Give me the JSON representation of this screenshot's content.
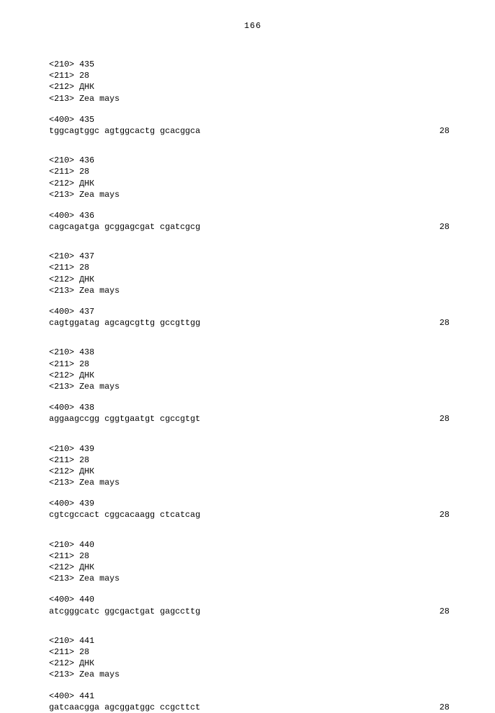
{
  "page_number": "166",
  "entries": [
    {
      "tag210": "<210> 435",
      "tag211": "<211> 28",
      "tag212": "<212> ДНК",
      "tag213": "<213> Zea mays",
      "tag400": "<400> 435",
      "sequence": "tggcagtggc agtggcactg gcacggca",
      "length": "28"
    },
    {
      "tag210": "<210> 436",
      "tag211": "<211> 28",
      "tag212": "<212> ДНК",
      "tag213": "<213> Zea mays",
      "tag400": "<400> 436",
      "sequence": "cagcagatga gcggagcgat cgatcgcg",
      "length": "28"
    },
    {
      "tag210": "<210> 437",
      "tag211": "<211> 28",
      "tag212": "<212> ДНК",
      "tag213": "<213> Zea mays",
      "tag400": "<400> 437",
      "sequence": "cagtggatag agcagcgttg gccgttgg",
      "length": "28"
    },
    {
      "tag210": "<210> 438",
      "tag211": "<211> 28",
      "tag212": "<212> ДНК",
      "tag213": "<213> Zea mays",
      "tag400": "<400> 438",
      "sequence": "aggaagccgg cggtgaatgt cgccgtgt",
      "length": "28"
    },
    {
      "tag210": "<210> 439",
      "tag211": "<211> 28",
      "tag212": "<212> ДНК",
      "tag213": "<213> Zea mays",
      "tag400": "<400> 439",
      "sequence": "cgtcgccact cggcacaagg ctcatcag",
      "length": "28"
    },
    {
      "tag210": "<210> 440",
      "tag211": "<211> 28",
      "tag212": "<212> ДНК",
      "tag213": "<213> Zea mays",
      "tag400": "<400> 440",
      "sequence": "atcgggcatc ggcgactgat gagccttg",
      "length": "28"
    },
    {
      "tag210": "<210> 441",
      "tag211": "<211> 28",
      "tag212": "<212> ДНК",
      "tag213": "<213> Zea mays",
      "tag400": "<400> 441",
      "sequence": "gatcaacgga agcggatggc ccgcttct",
      "length": "28"
    }
  ]
}
